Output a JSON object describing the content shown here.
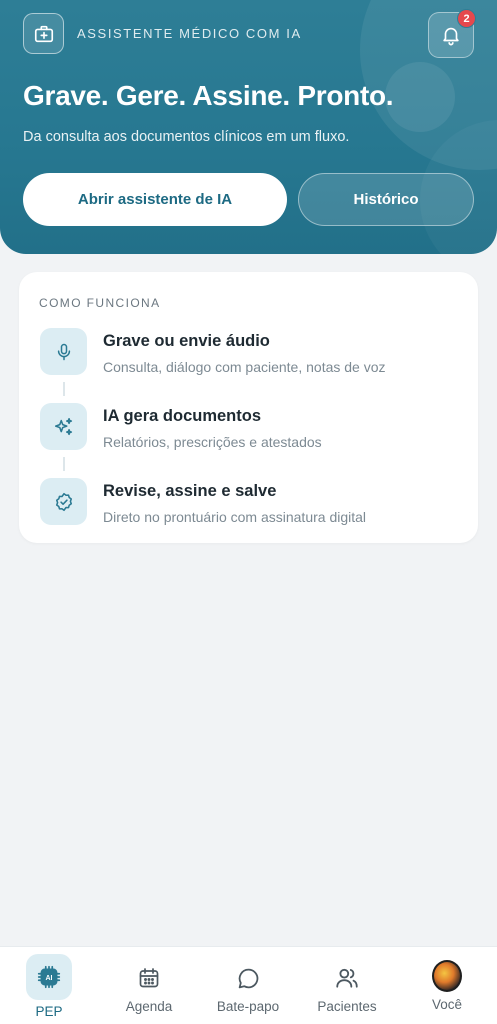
{
  "header": {
    "brand_label": "ASSISTENTE MÉDICO COM IA",
    "notification_count": "2",
    "title": "Grave. Gere. Assine. Pronto.",
    "subtitle": "Da consulta aos documentos clínicos em um fluxo.",
    "primary_button": "Abrir assistente de IA",
    "secondary_button": "Histórico",
    "background_color": "#277891"
  },
  "how_it_works": {
    "heading": "COMO FUNCIONA",
    "steps": [
      {
        "icon": "microphone-icon",
        "title": "Grave ou envie áudio",
        "description": "Consulta, diálogo com paciente, notas de voz"
      },
      {
        "icon": "sparkles-icon",
        "title": "IA gera documentos",
        "description": "Relatórios, prescrições e atestados"
      },
      {
        "icon": "verified-badge-icon",
        "title": "Revise, assine e salve",
        "description": "Direto no prontuário com assinatura digital"
      }
    ]
  },
  "bottom_nav": {
    "active": "PEP",
    "items": [
      {
        "label": "PEP",
        "icon": "ai-chip-icon"
      },
      {
        "label": "Agenda",
        "icon": "calendar-icon"
      },
      {
        "label": "Bate-papo",
        "icon": "chat-bubble-icon"
      },
      {
        "label": "Pacientes",
        "icon": "users-icon"
      },
      {
        "label": "Você",
        "icon": "avatar"
      }
    ]
  },
  "colors": {
    "accent": "#277891",
    "icon_tint": "#2b7a93",
    "badge": "#e5484d"
  }
}
